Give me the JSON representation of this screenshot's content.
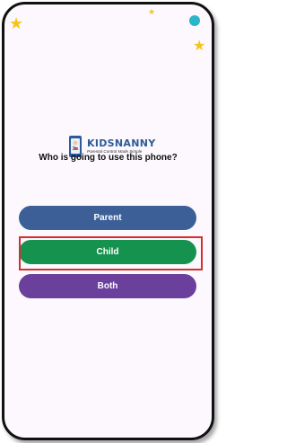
{
  "branding": {
    "name": "KIDSNANNY",
    "tagline": "Parental Control Made Simple"
  },
  "question": "Who is going to use this phone?",
  "options": {
    "parent": "Parent",
    "child": "Child",
    "both": "Both"
  },
  "colors": {
    "parent_button": "#3d5f98",
    "child_button": "#15934e",
    "both_button": "#6b3f9c",
    "highlight_box": "#d32f2f",
    "brand_blue": "#2e5b98"
  },
  "icons": [
    "star-icon",
    "kidsnanny-logo-icon"
  ]
}
